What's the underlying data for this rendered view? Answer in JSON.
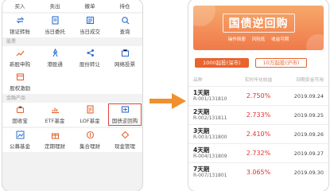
{
  "left": {
    "top_row": [
      "买入",
      "卖出",
      "撤单",
      "持仓"
    ],
    "row1": [
      "银证转账",
      "当日委托",
      "当日成交",
      "查询"
    ],
    "section_stock": "股票",
    "row2": [
      "新股申购",
      "港股通",
      "股份转让",
      "网络投票"
    ],
    "row3": [
      "股权激励"
    ],
    "section_finance": "金融产品",
    "row4": [
      "固收宝",
      "ETF基金",
      "LOF基金",
      "国债逆回购"
    ],
    "row5": [
      "公募基金",
      "定期理财",
      "集合理财",
      "现金管理"
    ]
  },
  "right": {
    "banner": {
      "title": "国债逆回购",
      "features": [
        "操作简便",
        "风险低",
        "收益可期"
      ]
    },
    "tabs": [
      "1000起投(深市)",
      "10万起投(沪市)"
    ],
    "table_header": {
      "name": "品种",
      "rate": "实时年化收益",
      "date": "到期资金可用"
    },
    "rows": [
      {
        "name": "1天期",
        "code": "R-001/131810",
        "rate": "2.750%",
        "date": "2019.09.24"
      },
      {
        "name": "2天期",
        "code": "R-002/131811",
        "rate": "2.733%",
        "date": "2019.09.25"
      },
      {
        "name": "3天期",
        "code": "R-003/131800",
        "rate": "2.410%",
        "date": "2019.09.26"
      },
      {
        "name": "4天期",
        "code": "R-004/131809",
        "rate": "2.732%",
        "date": "2019.09.27"
      },
      {
        "name": "7天期",
        "code": "R-007/131801",
        "rate": "3.065%",
        "date": "2019.09.30"
      }
    ]
  },
  "colors": {
    "accent": "#e8632e",
    "rate": "#e3342f",
    "highlight_box": "#e2403c"
  }
}
